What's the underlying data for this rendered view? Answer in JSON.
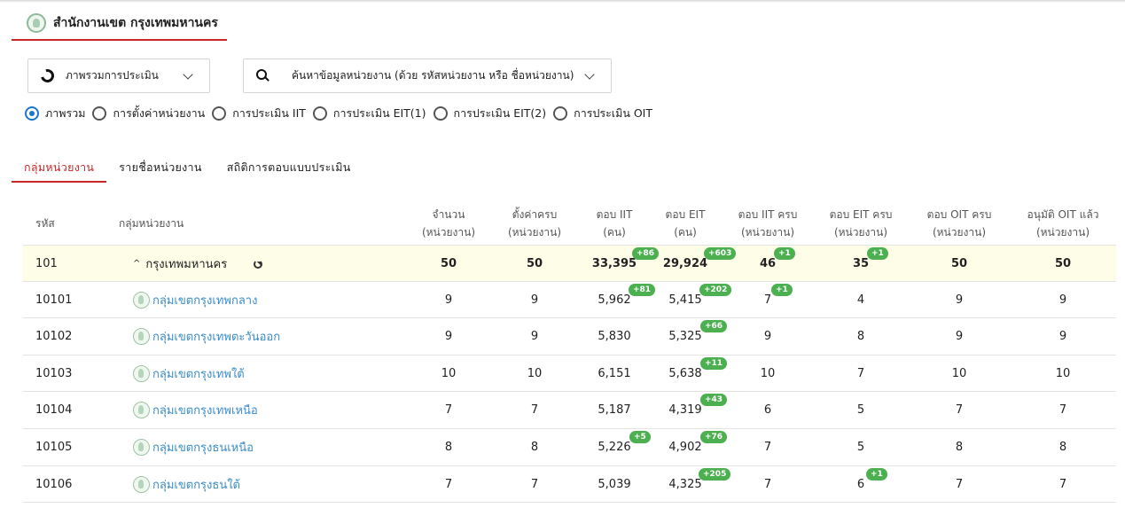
{
  "header": {
    "title": "สำนักงานเขต กรุงเทพมหานคร"
  },
  "view_select": {
    "value": "ภาพรวมการประเมิน"
  },
  "search_select": {
    "placeholder": "ค้นหาข้อมูลหน่วยงาน (ด้วย รหัสหน่วยงาน หรือ ชื่อหน่วยงาน)"
  },
  "radios": [
    {
      "label": "ภาพรวม",
      "selected": true
    },
    {
      "label": "การตั้งค่าหน่วยงาน",
      "selected": false
    },
    {
      "label": "การประเมิน IIT",
      "selected": false
    },
    {
      "label": "การประเมิน EIT(1)",
      "selected": false
    },
    {
      "label": "การประเมิน EIT(2)",
      "selected": false
    },
    {
      "label": "การประเมิน OIT",
      "selected": false
    }
  ],
  "tabs": [
    {
      "label": "กลุ่มหน่วยงาน",
      "active": true
    },
    {
      "label": "รายชื่อหน่วยงาน",
      "active": false
    },
    {
      "label": "สถิติการตอบแบบประเมิน",
      "active": false
    }
  ],
  "table": {
    "headers": {
      "code": "รหัส",
      "group": "กลุ่มหน่วยงาน",
      "units": [
        "จำนวน",
        "(หน่วยงาน)"
      ],
      "configured": [
        "ตั้งค่าครบ",
        "(หน่วยงาน)"
      ],
      "iit": [
        "ตอบ IIT",
        "(คน)"
      ],
      "eit": [
        "ตอบ EIT",
        "(คน)"
      ],
      "iit_done": [
        "ตอบ IIT ครบ",
        "(หน่วยงาน)"
      ],
      "eit_done": [
        "ตอบ EIT ครบ",
        "(หน่วยงาน)"
      ],
      "oit_done": [
        "ตอบ OIT ครบ",
        "(หน่วยงาน)"
      ],
      "oit_approved": [
        "อนุมัติ OIT แล้ว",
        "(หน่วยงาน)"
      ]
    },
    "total_row": {
      "code": "101",
      "group": "กรุงเทพมหานคร",
      "units": "50",
      "configured": "50",
      "iit": "33,395",
      "iit_badge": "+86",
      "eit": "29,924",
      "eit_badge": "+603",
      "iit_done": "46",
      "iit_done_badge": "+1",
      "eit_done": "35",
      "eit_done_badge": "+1",
      "oit_done": "50",
      "oit_approved": "50"
    },
    "rows": [
      {
        "code": "10101",
        "group": "กลุ่มเขตกรุงเทพกลาง",
        "units": "9",
        "configured": "9",
        "iit": "5,962",
        "iit_badge": "+81",
        "eit": "5,415",
        "eit_badge": "+202",
        "iit_done": "7",
        "iit_done_badge": "+1",
        "eit_done": "4",
        "eit_done_badge": "",
        "oit_done": "9",
        "oit_approved": "9"
      },
      {
        "code": "10102",
        "group": "กลุ่มเขตกรุงเทพตะวันออก",
        "units": "9",
        "configured": "9",
        "iit": "5,830",
        "iit_badge": "",
        "eit": "5,325",
        "eit_badge": "+66",
        "iit_done": "9",
        "iit_done_badge": "",
        "eit_done": "8",
        "eit_done_badge": "",
        "oit_done": "9",
        "oit_approved": "9"
      },
      {
        "code": "10103",
        "group": "กลุ่มเขตกรุงเทพใต้",
        "units": "10",
        "configured": "10",
        "iit": "6,151",
        "iit_badge": "",
        "eit": "5,638",
        "eit_badge": "+11",
        "iit_done": "10",
        "iit_done_badge": "",
        "eit_done": "7",
        "eit_done_badge": "",
        "oit_done": "10",
        "oit_approved": "10"
      },
      {
        "code": "10104",
        "group": "กลุ่มเขตกรุงเทพเหนือ",
        "units": "7",
        "configured": "7",
        "iit": "5,187",
        "iit_badge": "",
        "eit": "4,319",
        "eit_badge": "+43",
        "iit_done": "6",
        "iit_done_badge": "",
        "eit_done": "5",
        "eit_done_badge": "",
        "oit_done": "7",
        "oit_approved": "7"
      },
      {
        "code": "10105",
        "group": "กลุ่มเขตกรุงธนเหนือ",
        "units": "8",
        "configured": "8",
        "iit": "5,226",
        "iit_badge": "+5",
        "eit": "4,902",
        "eit_badge": "+76",
        "iit_done": "7",
        "iit_done_badge": "",
        "eit_done": "5",
        "eit_done_badge": "",
        "oit_done": "8",
        "oit_approved": "8"
      },
      {
        "code": "10106",
        "group": "กลุ่มเขตกรุงธนใต้",
        "units": "7",
        "configured": "7",
        "iit": "5,039",
        "iit_badge": "",
        "eit": "4,325",
        "eit_badge": "+205",
        "iit_done": "7",
        "iit_done_badge": "",
        "eit_done": "6",
        "eit_done_badge": "+1",
        "oit_done": "7",
        "oit_approved": "7"
      }
    ]
  }
}
